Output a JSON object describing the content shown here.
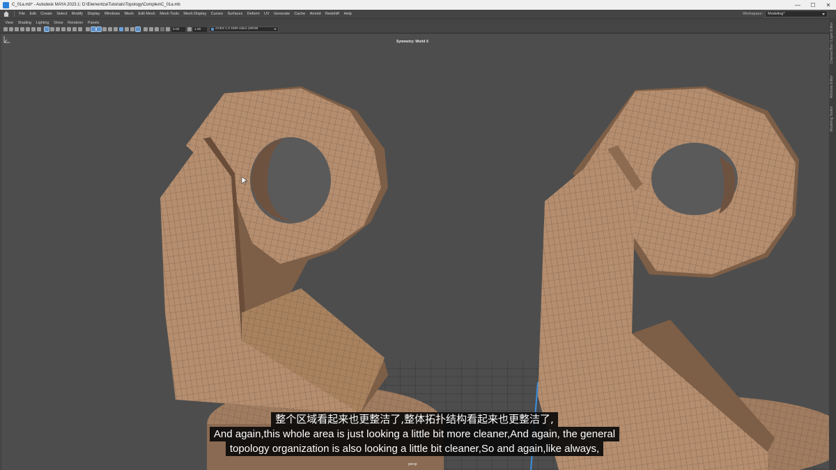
{
  "window": {
    "title": "C_01a.mb* - Autodesk MAYA 2023.1: D:\\Elementza\\Tutorials\\Topology\\Complex\\C_01a.mb",
    "minimize": "—",
    "maximize": "☐",
    "close": "✕"
  },
  "menu": {
    "items": [
      "File",
      "Edit",
      "Create",
      "Select",
      "Modify",
      "Display",
      "Windows",
      "Mesh",
      "Edit Mesh",
      "Mesh Tools",
      "Mesh Display",
      "Curves",
      "Surfaces",
      "Deform",
      "UV",
      "Generate",
      "Cache",
      "Arnold",
      "Redshift",
      "Help"
    ],
    "workspace_label": "Workspace:",
    "workspace_value": "Modeling*"
  },
  "panel_menu": {
    "items": [
      "View",
      "Shading",
      "Lighting",
      "Show",
      "Renderer",
      "Panels"
    ]
  },
  "toolbar": {
    "field_1": "0.00",
    "field_2": "1.00",
    "color_space": "ACES 1.0 SDR-video (sRGB"
  },
  "viewport": {
    "symmetry": "Symmetry: World X",
    "camera": "persp",
    "model_color": "#b08a6c",
    "wire_color": "#6e5240"
  },
  "side_tabs": [
    "Channel Box / Layer Editor",
    "Attribute Editor",
    "Modeling Toolkit"
  ],
  "subtitles": {
    "zh": "整个区域看起来也更整洁了,整体拓扑结构看起来也更整洁了,",
    "en_1": "And again,this whole area is just looking a little bit more cleaner,And again, the general",
    "en_2": "topology organization is also looking a little bit cleaner,So and again,like always,"
  }
}
